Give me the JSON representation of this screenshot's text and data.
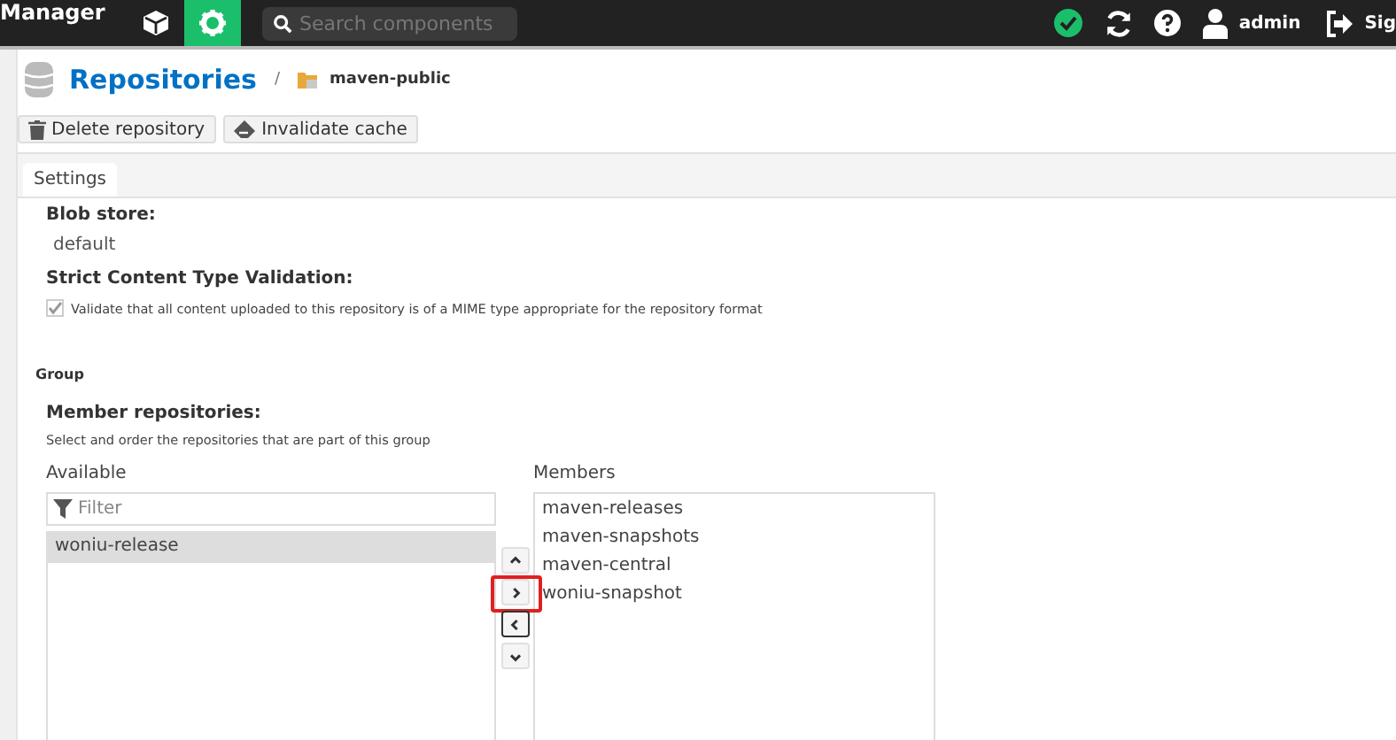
{
  "topbar": {
    "title": "Manager",
    "nav": [
      {
        "kind": "browse",
        "selected": false
      },
      {
        "kind": "admin",
        "selected": true
      }
    ],
    "search": {
      "placeholder": "Search components"
    },
    "user": "admin",
    "signout": "Sig"
  },
  "breadcrumb": {
    "root": "Repositories",
    "separator": "/",
    "current": "maven-public"
  },
  "actions": [
    {
      "kind": "delete",
      "label": "Delete repository"
    },
    {
      "kind": "invalidate",
      "label": "Invalidate cache"
    }
  ],
  "tabs": [
    {
      "label": "Settings",
      "selected": true
    }
  ],
  "blob_store": {
    "label": "Blob store:",
    "value": "default"
  },
  "strict_validation": {
    "label": "Strict Content Type Validation:",
    "checked": true,
    "text": "Validate that all content uploaded to this repository is of a MIME type appropriate for the repository format"
  },
  "group": {
    "heading": "Group",
    "label": "Member repositories:",
    "help": "Select and order the repositories that are part of this group",
    "available": {
      "title": "Available",
      "filter_placeholder": "Filter",
      "items": [
        {
          "name": "woniu-release",
          "selected": true
        }
      ]
    },
    "members": {
      "title": "Members",
      "items": [
        {
          "name": "maven-releases",
          "selected": false
        },
        {
          "name": "maven-snapshots",
          "selected": false
        },
        {
          "name": "maven-central",
          "selected": false
        },
        {
          "name": "woniu-snapshot",
          "selected": false
        }
      ]
    },
    "move_buttons": [
      {
        "kind": "up",
        "focused": false,
        "highlighted": false
      },
      {
        "kind": "right",
        "focused": false,
        "highlighted": true
      },
      {
        "kind": "left",
        "focused": true,
        "highlighted": false
      },
      {
        "kind": "down",
        "focused": false,
        "highlighted": false
      }
    ]
  }
}
